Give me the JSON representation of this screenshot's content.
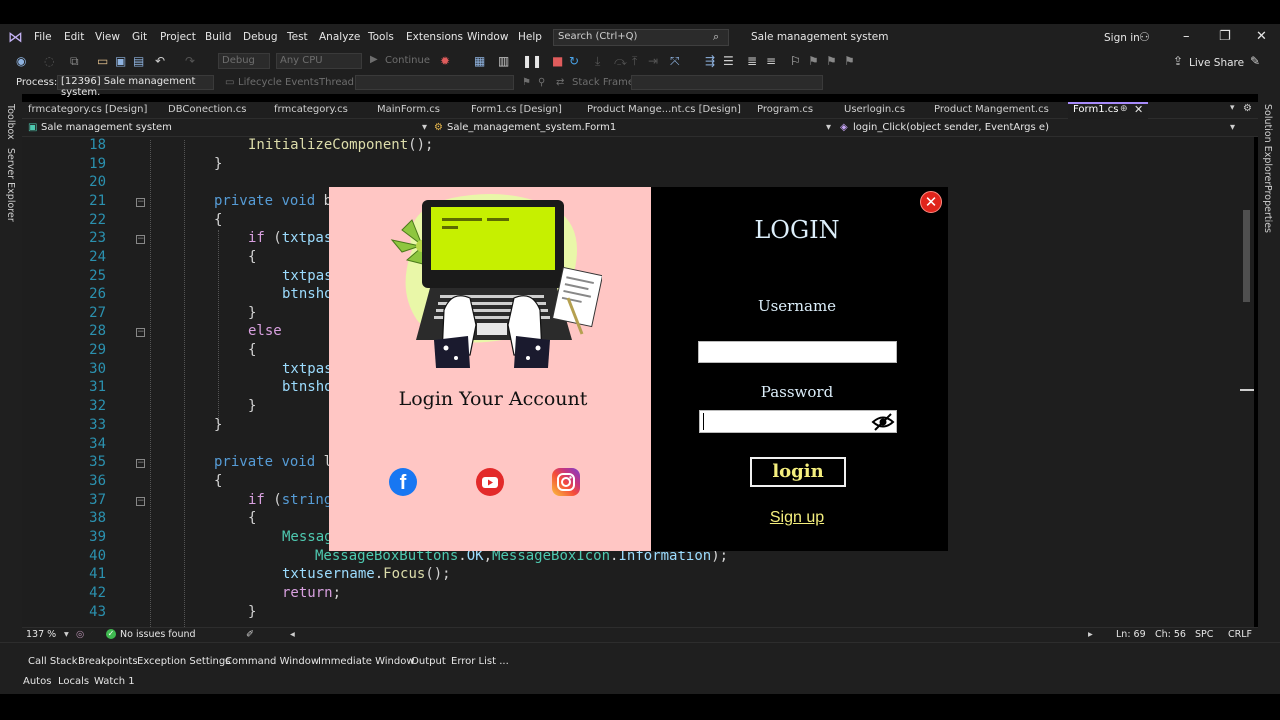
{
  "menu": {
    "items": [
      "File",
      "Edit",
      "View",
      "Git",
      "Project",
      "Build",
      "Debug",
      "Test",
      "Analyze",
      "Tools",
      "Extensions",
      "Window",
      "Help"
    ],
    "search_placeholder": "Search (Ctrl+Q)",
    "solution_title": "Sale management system",
    "sign_in": "Sign in"
  },
  "toolbar": {
    "config": "Debug",
    "platform": "Any CPU",
    "continue": "Continue",
    "live_share": "Live Share"
  },
  "toolbar2": {
    "process_label": "Process:",
    "process_value": "[12396] Sale management system.",
    "lifecycle": "Lifecycle Events",
    "thread": "Thread:",
    "stack_frame": "Stack Frame:"
  },
  "side": {
    "left": [
      "Toolbox",
      "Server Explorer"
    ],
    "right": [
      "Solution Explorer",
      "Properties"
    ]
  },
  "tabs": {
    "items": [
      "frmcategory.cs [Design]",
      "DBConection.cs",
      "frmcategory.cs",
      "MainForm.cs",
      "Form1.cs [Design]",
      "Product Mange...nt.cs [Design]",
      "Program.cs",
      "Userlogin.cs",
      "Product Mangement.cs"
    ],
    "active": "Form1.cs"
  },
  "navbar": {
    "project": "Sale management system",
    "class": "Sale_management_system.Form1",
    "member": "login_Click(object sender, EventArgs e)"
  },
  "editor": {
    "line_numbers": [
      "18",
      "19",
      "20",
      "21",
      "22",
      "23",
      "24",
      "25",
      "26",
      "27",
      "28",
      "29",
      "30",
      "31",
      "32",
      "33",
      "34",
      "35",
      "36",
      "37",
      "38",
      "39",
      "40",
      "41",
      "42",
      "43"
    ]
  },
  "status": {
    "zoom": "137 %",
    "issues": "No issues found",
    "line": "Ln: 69",
    "col": "Ch: 56",
    "spacing": "SPC",
    "eol": "CRLF"
  },
  "bottom_tabs": {
    "row1": [
      "Call Stack",
      "Breakpoints",
      "Exception Settings",
      "Command Window",
      "Immediate Window",
      "Output",
      "Error List ..."
    ],
    "row2": [
      "Autos",
      "Locals",
      "Watch 1"
    ]
  },
  "login_form": {
    "title": "LOGIN",
    "caption": "Login Your Account",
    "username_label": "Username",
    "username_value": "",
    "password_label": "Password",
    "password_value": "",
    "login_button": "login",
    "signup_link": "Sign up",
    "close_symbol": "✕",
    "facebook_symbol": "f",
    "colors": {
      "left_panel": "#ffc6c4",
      "right_panel": "#000000",
      "accent_yellow": "#f5ef7e",
      "close_red": "#e0241c"
    },
    "icons": [
      "facebook-icon",
      "youtube-icon",
      "instagram-icon",
      "eye-slash-icon",
      "close-icon"
    ]
  }
}
